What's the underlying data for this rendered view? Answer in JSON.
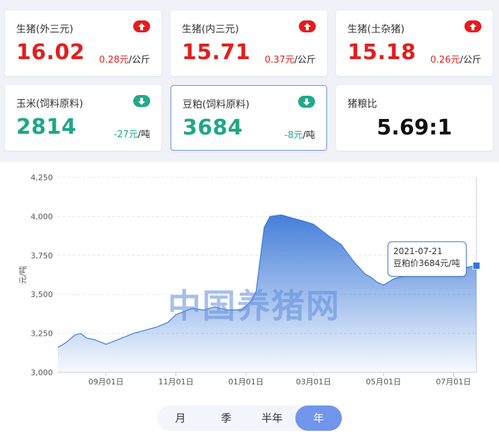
{
  "cards": [
    {
      "title": "生猪(外三元)",
      "value": "16.02",
      "change": "0.28元",
      "unit": "/公斤",
      "direction": "up"
    },
    {
      "title": "生猪(内三元)",
      "value": "15.71",
      "change": "0.37元",
      "unit": "/公斤",
      "direction": "up"
    },
    {
      "title": "生猪(土杂猪)",
      "value": "15.18",
      "change": "0.26元",
      "unit": "/公斤",
      "direction": "up"
    },
    {
      "title": "玉米(饲料原料)",
      "value": "2814",
      "change": "-27元",
      "unit": "/吨",
      "direction": "down"
    },
    {
      "title": "豆粕(饲料原料)",
      "value": "3684",
      "change": "-8元",
      "unit": "/吨",
      "direction": "down",
      "selected": true
    },
    {
      "title": "猪粮比",
      "value": "5.69:1"
    }
  ],
  "colors": {
    "up": "#e0201e",
    "down": "#1fa787",
    "line": "#3b78d8",
    "accent": "#7295ec"
  },
  "icons": {
    "up": "arrow-up-icon",
    "down": "arrow-down-icon"
  },
  "watermark": "中国养猪网",
  "tooltip": {
    "date": "2021-07-21",
    "text": "豆粕价3684元/吨"
  },
  "periods": {
    "options": [
      "月",
      "季",
      "半年",
      "年"
    ],
    "selected": "年"
  },
  "chart_data": {
    "type": "area",
    "ylabel": "元/吨",
    "ylim": [
      3000,
      4250
    ],
    "yticks": [
      3000,
      3250,
      3500,
      3750,
      4000,
      4250
    ],
    "ytick_labels": [
      "3,000",
      "3,250",
      "3,500",
      "3,750",
      "4,000",
      "4,250"
    ],
    "xlim": [
      "2020-07-21",
      "2021-07-21"
    ],
    "xticks": [
      "2020-09-01",
      "2020-11-01",
      "2021-01-01",
      "2021-03-01",
      "2021-05-01",
      "2021-07-01"
    ],
    "xtick_labels": [
      "09月01日",
      "11月01日",
      "01月01日",
      "03月01日",
      "05月01日",
      "07月01日"
    ],
    "grid": true,
    "series": [
      {
        "name": "豆粕价",
        "x": [
          "2020-07-21",
          "2020-07-28",
          "2020-08-05",
          "2020-08-10",
          "2020-08-15",
          "2020-08-22",
          "2020-09-01",
          "2020-09-08",
          "2020-09-15",
          "2020-09-25",
          "2020-10-05",
          "2020-10-15",
          "2020-10-25",
          "2020-11-01",
          "2020-11-08",
          "2020-11-15",
          "2020-11-25",
          "2020-12-05",
          "2020-12-15",
          "2020-12-28",
          "2021-01-05",
          "2021-01-10",
          "2021-01-13",
          "2021-01-17",
          "2021-01-22",
          "2021-02-01",
          "2021-02-10",
          "2021-02-20",
          "2021-03-01",
          "2021-03-15",
          "2021-03-25",
          "2021-04-05",
          "2021-04-15",
          "2021-04-20",
          "2021-04-25",
          "2021-05-01",
          "2021-05-10",
          "2021-05-20",
          "2021-06-01",
          "2021-06-10",
          "2021-06-20",
          "2021-07-01",
          "2021-07-10",
          "2021-07-21"
        ],
        "y": [
          3160,
          3190,
          3240,
          3250,
          3220,
          3210,
          3180,
          3200,
          3220,
          3250,
          3270,
          3290,
          3320,
          3370,
          3390,
          3410,
          3400,
          3420,
          3400,
          3400,
          3450,
          3520,
          3700,
          3930,
          4000,
          4010,
          3990,
          3970,
          3950,
          3870,
          3820,
          3710,
          3630,
          3610,
          3580,
          3560,
          3600,
          3620,
          3630,
          3640,
          3650,
          3680,
          3670,
          3684
        ]
      }
    ]
  }
}
